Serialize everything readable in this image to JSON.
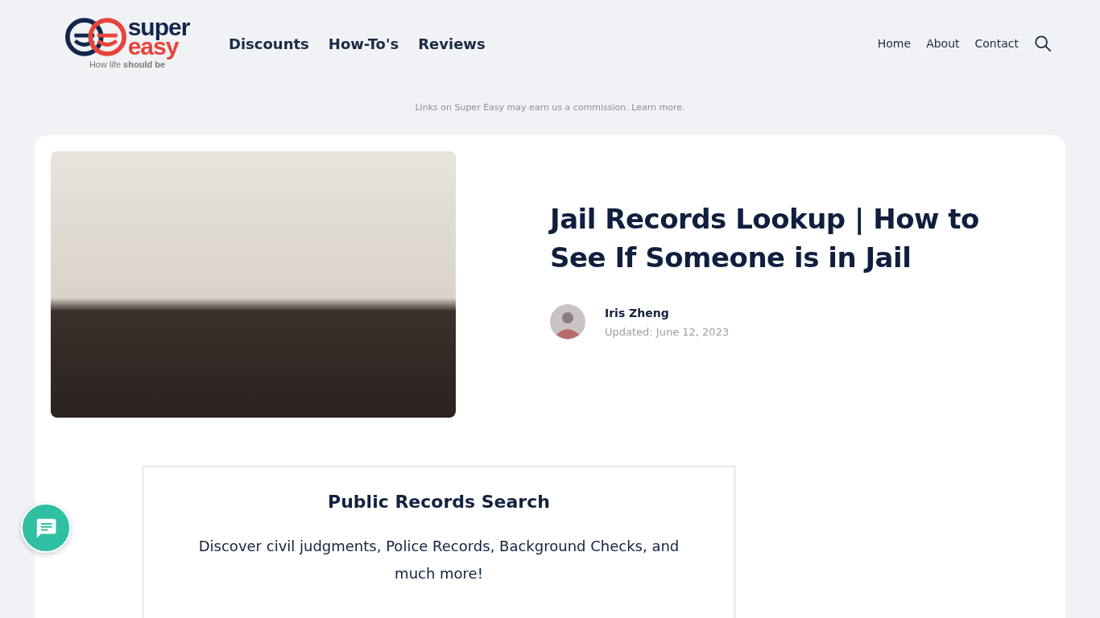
{
  "logo": {
    "word_top": "super",
    "word_bottom": "easy",
    "tagline": "How life **should be**"
  },
  "main_nav": [
    {
      "label": "Discounts"
    },
    {
      "label": "How-To's"
    },
    {
      "label": "Reviews"
    }
  ],
  "secondary_nav": [
    {
      "label": "Home"
    },
    {
      "label": "About"
    },
    {
      "label": "Contact"
    }
  ],
  "disclaimer": {
    "text": "Links on Super Easy may earn us a commission.",
    "link": "Learn more."
  },
  "article": {
    "title": "Jail Records Lookup | How to See If Someone is in Jail",
    "author": "Iris Zheng",
    "updated": "Updated: June 12, 2023"
  },
  "search_box": {
    "title": "Public Records Search",
    "description": "Discover civil judgments, Police Records, Background Checks, and much more!"
  }
}
